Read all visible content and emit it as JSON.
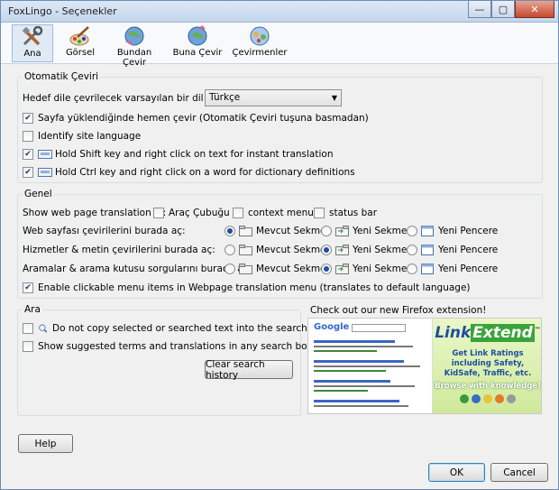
{
  "window": {
    "title": "FoxLingo - Seçenekler",
    "controls": {
      "minimize": "—",
      "maximize": "▢",
      "close": "✕"
    }
  },
  "toolbar": {
    "tabs": [
      {
        "label": "Ana",
        "icon": "tools-icon",
        "active": true
      },
      {
        "label": "Görsel",
        "icon": "paintbrush-icon",
        "active": false
      },
      {
        "label": "Bundan Çevir",
        "icon": "translate-from-icon",
        "active": false
      },
      {
        "label": "Buna Çevir",
        "icon": "translate-to-icon",
        "active": false
      },
      {
        "label": "Çevirmenler",
        "icon": "translators-icon",
        "active": false
      }
    ]
  },
  "auto_translate": {
    "title": "Otomatik Çeviri",
    "target_lang_label": "Hedef dile çevrilecek varsayılan bir dil seçin:",
    "target_lang_value": "Türkçe",
    "options": [
      {
        "label": "Sayfa yüklendiğinde hemen çevir (Otomatik Çeviri tuşuna basmadan)",
        "checked": true
      },
      {
        "label": "Identify site language",
        "checked": false
      },
      {
        "label": "Hold Shift key and right click on text for instant translation",
        "checked": true
      },
      {
        "label": "Hold Ctrl key and right click on a word for dictionary definitions",
        "checked": true
      }
    ]
  },
  "general": {
    "title": "Genel",
    "show_in_label": "Show web page translation in:",
    "show_in": [
      {
        "label": "Araç Çubuğu",
        "checked": false
      },
      {
        "label": "context menu",
        "checked": false
      },
      {
        "label": "status bar",
        "checked": false
      }
    ],
    "open_rows": [
      {
        "label": "Web sayfası çevirilerini burada aç:",
        "selected": 0
      },
      {
        "label": "Hizmetler & metin çevirilerini burada aç:",
        "selected": 1
      },
      {
        "label": "Aramalar & arama kutusu sorgularını burada aç:",
        "selected": 1
      }
    ],
    "open_options": [
      "Mevcut Sekme",
      "Yeni Sekme",
      "Yeni Pencere"
    ],
    "clickable_menu_label": "Enable clickable menu items in Webpage translation menu (translates to default language)",
    "clickable_menu_checked": true
  },
  "search": {
    "title": "Ara",
    "options": [
      {
        "label": "Do not copy selected or searched text into the search box",
        "checked": false
      },
      {
        "label": "Show suggested terms and translations in any search box",
        "checked": false
      }
    ],
    "clear_button": "Clear search history"
  },
  "promo": {
    "title": "Check out our new Firefox extension!",
    "google_logo": "Google",
    "brand_part1": "Link",
    "brand_part2": "Extend",
    "tm": "™",
    "tagline": "Get Link Ratings including Safety, KidSafe, Traffic, etc.",
    "cta": "Browse with knowledge!"
  },
  "footer": {
    "help": "Help",
    "ok": "OK",
    "cancel": "Cancel"
  },
  "colors": {
    "accent": "#1f4f9a",
    "promo_bg": "#d8eeaa"
  }
}
